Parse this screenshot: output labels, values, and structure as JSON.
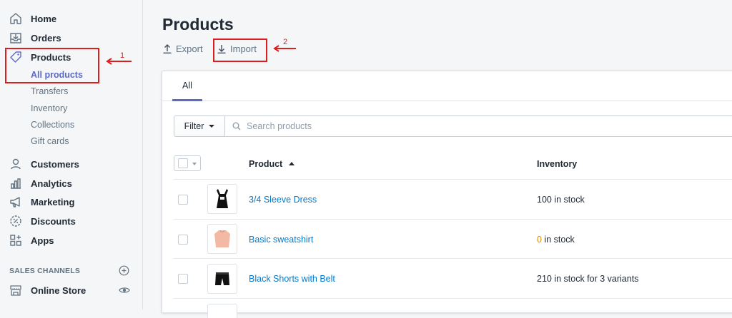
{
  "sidebar": {
    "home": "Home",
    "orders": "Orders",
    "products": "Products",
    "products_sub": [
      "All products",
      "Transfers",
      "Inventory",
      "Collections",
      "Gift cards"
    ],
    "customers": "Customers",
    "analytics": "Analytics",
    "marketing": "Marketing",
    "discounts": "Discounts",
    "apps": "Apps",
    "sales_channels_heading": "SALES CHANNELS",
    "online_store": "Online Store"
  },
  "page": {
    "title": "Products",
    "export_label": "Export",
    "import_label": "Import"
  },
  "tabs": [
    "All"
  ],
  "filter": {
    "button_label": "Filter",
    "search_placeholder": "Search products"
  },
  "table": {
    "columns": [
      "Product",
      "Inventory"
    ],
    "rows": [
      {
        "name": "3/4 Sleeve Dress",
        "inventory_count": "100",
        "inventory_suffix": " in stock"
      },
      {
        "name": "Basic sweatshirt",
        "inventory_count": "0",
        "inventory_suffix": " in stock"
      },
      {
        "name": "Black Shorts with Belt",
        "inventory_count": "210",
        "inventory_suffix": " in stock for 3 variants"
      }
    ]
  },
  "annotations": [
    "1",
    "2"
  ],
  "colors": {
    "accent": "#5c6ac4",
    "link": "#007ace",
    "annotation": "#e01d1d",
    "warning": "#de8a00"
  }
}
